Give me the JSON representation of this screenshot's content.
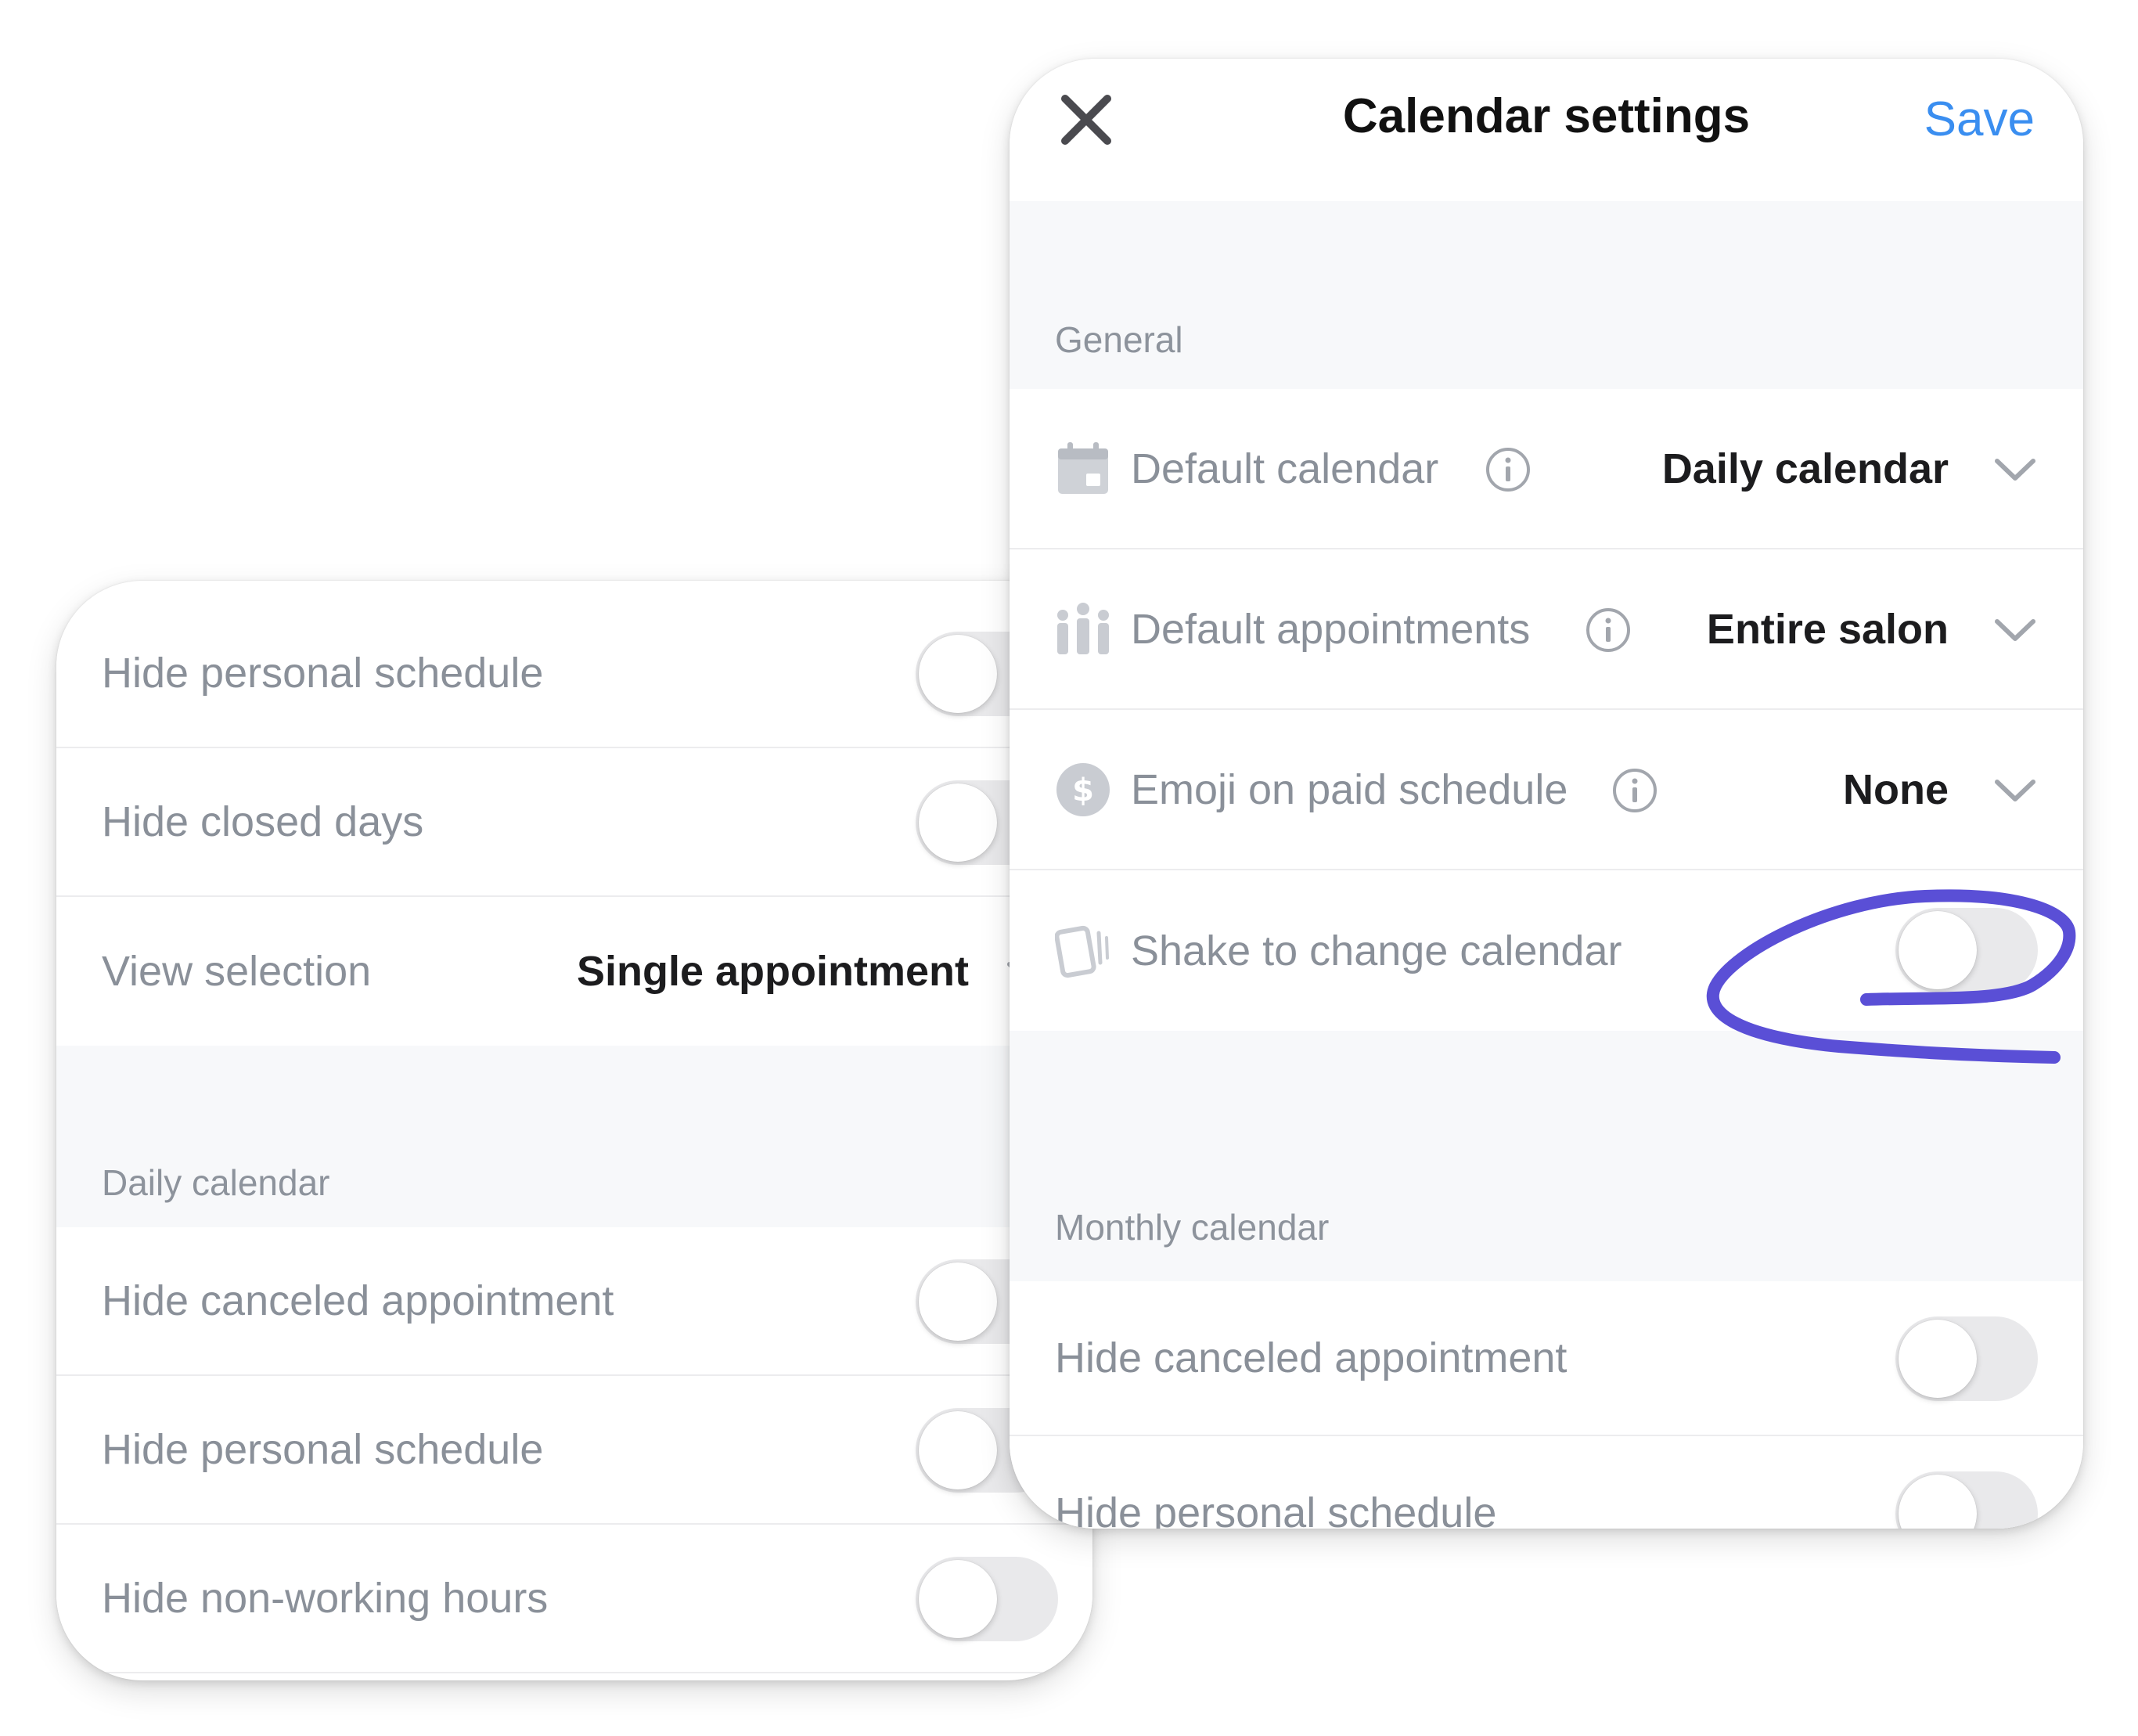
{
  "back_panel": {
    "rows_top": [
      {
        "label": "Hide personal schedule",
        "toggle_on": false
      },
      {
        "label": "Hide closed days",
        "toggle_on": false
      }
    ],
    "view_selection": {
      "label": "View selection",
      "value": "Single appointment"
    },
    "daily_section": {
      "title": "Daily calendar",
      "rows": [
        {
          "label": "Hide canceled appointment",
          "toggle_on": false
        },
        {
          "label": "Hide personal schedule",
          "toggle_on": false
        },
        {
          "label": "Hide non-working hours",
          "toggle_on": false
        }
      ]
    }
  },
  "front_panel": {
    "header": {
      "title": "Calendar settings",
      "save_label": "Save",
      "close_icon": "close-icon"
    },
    "general_section": {
      "title": "General",
      "rows": [
        {
          "label": "Default calendar",
          "value": "Daily calendar",
          "icon": "calendar-icon"
        },
        {
          "label": "Default appointments",
          "value": "Entire salon",
          "icon": "people-icon"
        },
        {
          "label": "Emoji on paid schedule",
          "value": "None",
          "icon": "dollar-icon"
        }
      ],
      "shake_row": {
        "label": "Shake to change calendar",
        "icon": "shake-phone-icon",
        "toggle_on": false
      }
    },
    "monthly_section": {
      "title": "Monthly calendar",
      "rows": [
        {
          "label": "Hide canceled appointment",
          "toggle_on": false
        },
        {
          "label": "Hide personal schedule",
          "toggle_on": false
        }
      ]
    }
  },
  "colors": {
    "accent": "#3a8ef0",
    "annotation": "#5a4fd6",
    "toggle_off": "#e9e9eb",
    "section_bg": "#f7f8fa"
  }
}
